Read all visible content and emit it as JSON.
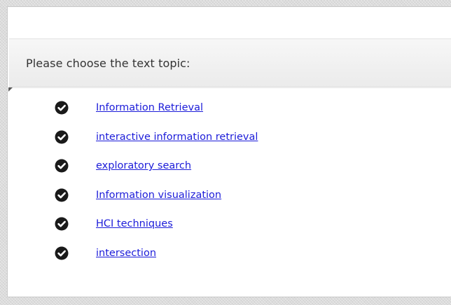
{
  "header": {
    "title": "Please choose the text topic:"
  },
  "topics": [
    {
      "label": "Information Retrieval",
      "icon": "check-circle-icon"
    },
    {
      "label": "interactive information retrieval",
      "icon": "check-circle-icon"
    },
    {
      "label": "exploratory search",
      "icon": "check-circle-icon"
    },
    {
      "label": "Information visualization",
      "icon": "check-circle-icon"
    },
    {
      "label": "HCI techniques",
      "icon": "check-circle-icon"
    },
    {
      "label": "intersection",
      "icon": "check-circle-icon"
    }
  ],
  "colors": {
    "link": "#1c1cd9",
    "icon": "#1a1a1a",
    "header_text": "#333333"
  }
}
